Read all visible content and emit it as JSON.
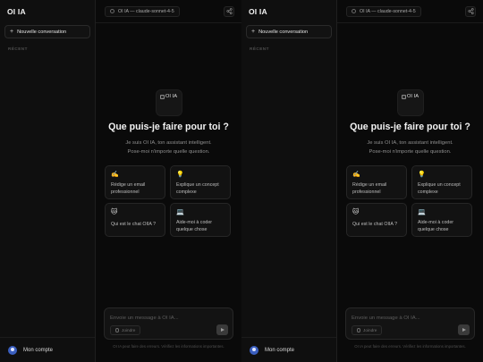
{
  "app": {
    "name": "OI IA"
  },
  "sidebar": {
    "new_chat_label": "Nouvelle conversation",
    "recent_label": "RÉCENT",
    "account_label": "Mon compte"
  },
  "topbar": {
    "model_label": "OI IA — claude-sonnet-4-5"
  },
  "hero": {
    "logo_alt": "OI IA",
    "headline": "Que puis-je faire pour toi ?",
    "subtitle_line1": "Je suis OI IA, ton assistant intelligent.",
    "subtitle_line2": "Pose-moi n'importe quelle question."
  },
  "suggestions": [
    {
      "icon": "✍️",
      "icon_name": "writing-hand-icon",
      "text": "Rédige un email professionnel"
    },
    {
      "icon": "💡",
      "icon_name": "lightbulb-icon",
      "text": "Explique un concept complexe"
    },
    {
      "icon": "🐱",
      "icon_name": "cat-icon",
      "text": "Qui est le chat OIIA ?"
    },
    {
      "icon": "💻",
      "icon_name": "laptop-icon",
      "text": "Aide-moi à coder quelque chose"
    }
  ],
  "composer": {
    "placeholder": "Envoie un message à OI IA...",
    "attach_label": "Joindre"
  },
  "disclaimer": "OI IA peut faire des erreurs. Vérifiez les informations importantes."
}
